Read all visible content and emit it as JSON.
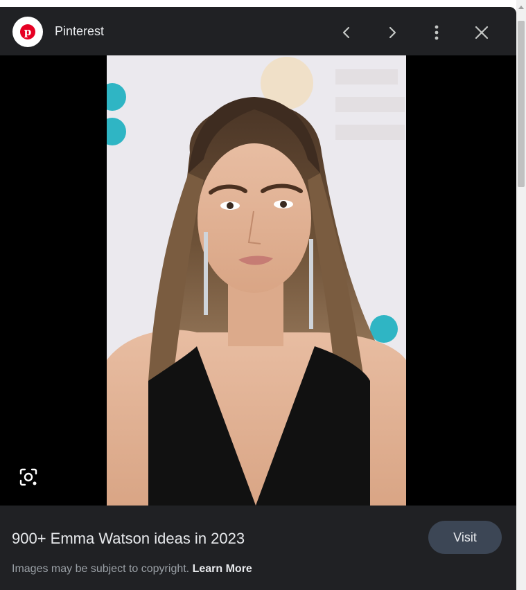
{
  "header": {
    "source_name": "Pinterest",
    "logo_letter": "p",
    "brand_color": "#e60023",
    "prev_icon": "chevron-left-icon",
    "next_icon": "chevron-right-icon",
    "more_icon": "more-vert-icon",
    "close_icon": "close-icon"
  },
  "image": {
    "alt": "Emma Watson"
  },
  "footer": {
    "title": "900+ Emma Watson ideas in 2023",
    "visit_label": "Visit",
    "copyright_text": "Images may be subject to copyright.",
    "learn_more_label": "Learn More"
  },
  "colors": {
    "panel_bg": "#202124",
    "viewer_bg": "#000000",
    "visit_button_bg": "#3c4655"
  }
}
